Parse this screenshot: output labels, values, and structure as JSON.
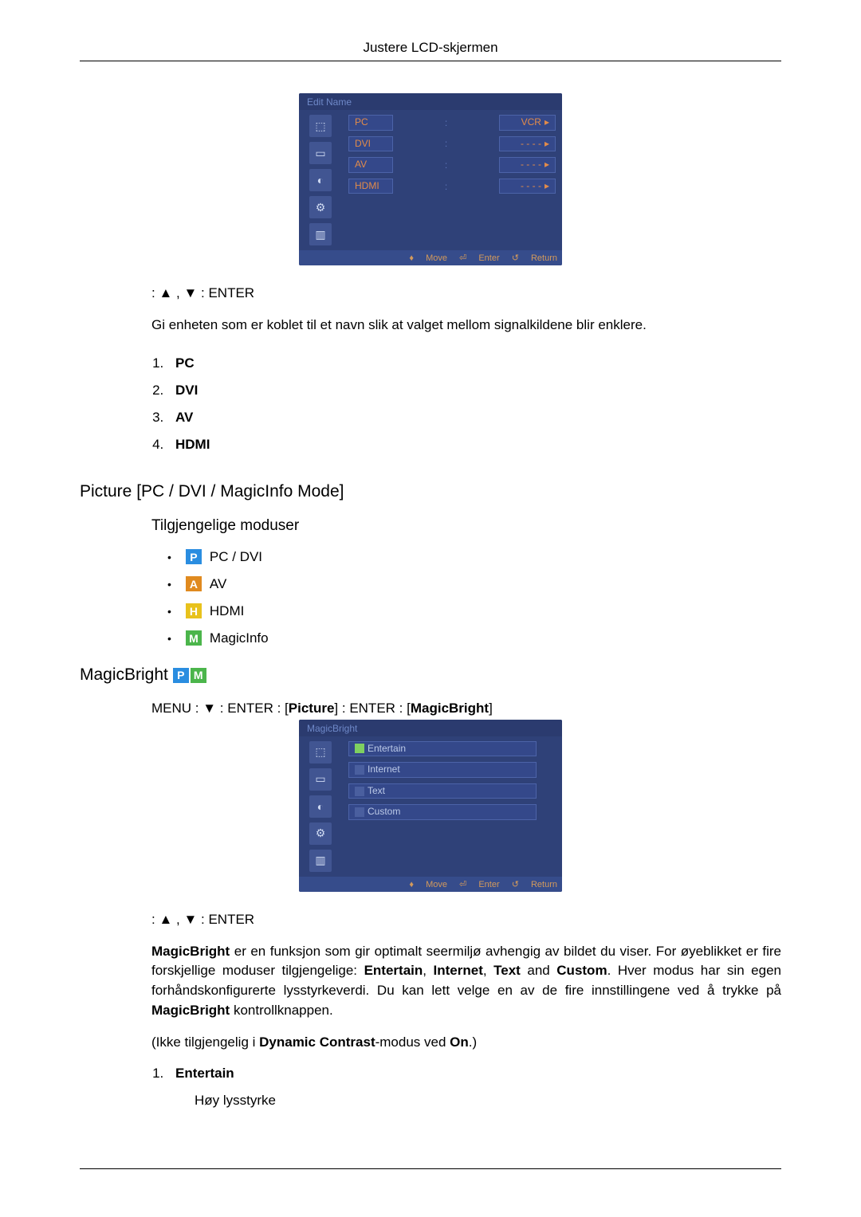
{
  "header": {
    "title": "Justere LCD-skjermen"
  },
  "osd1": {
    "title": "Edit Name",
    "rows": [
      {
        "label": "PC",
        "value": "VCR",
        "arrow": "▸"
      },
      {
        "label": "DVI",
        "value": "- - - -",
        "arrow": "▸"
      },
      {
        "label": "AV",
        "value": "- - - -",
        "arrow": "▸"
      },
      {
        "label": "HDMI",
        "value": "- - - -",
        "arrow": "▸"
      }
    ],
    "footer": {
      "move": "Move",
      "enter": "Enter",
      "ret": "Return"
    }
  },
  "nav1": {
    "prefix": ":  ▲ , ▼  :",
    "enter": "ENTER"
  },
  "intro1": "Gi enheten som er koblet til et navn slik at valget mellom signalkildene blir enklere.",
  "sourceList": [
    "PC",
    "DVI",
    "AV",
    "HDMI"
  ],
  "section1": {
    "title": "Picture [PC / DVI / MagicInfo Mode]"
  },
  "subsection1": {
    "title": "Tilgjengelige moduser"
  },
  "modes": [
    {
      "badge": "P",
      "label": "PC / DVI"
    },
    {
      "badge": "A",
      "label": "AV"
    },
    {
      "badge": "H",
      "label": "HDMI"
    },
    {
      "badge": "M",
      "label": "MagicInfo"
    }
  ],
  "section2": {
    "title": "MagicBright"
  },
  "menupath": {
    "p1": "MENU  :  ▼  :",
    "e1": "ENTER",
    "sep1": "  : [",
    "pic": "Picture",
    "sep2": "]  :",
    "e2": "ENTER",
    "sep3": "  : [",
    "mb": "MagicBright",
    "sep4": "]"
  },
  "osd2": {
    "title": "MagicBright",
    "rows": [
      {
        "label": "Entertain",
        "selected": true
      },
      {
        "label": "Internet",
        "selected": false
      },
      {
        "label": "Text",
        "selected": false
      },
      {
        "label": "Custom",
        "selected": false
      }
    ],
    "footer": {
      "move": "Move",
      "enter": "Enter",
      "ret": "Return"
    }
  },
  "nav2": {
    "prefix": ":  ▲ , ▼  :",
    "enter": "ENTER"
  },
  "mbPara": {
    "b1": "MagicBright",
    "t1": " er en funksjon som gir optimalt seermiljø avhengig av bildet du viser. For øyeblikket er fire forskjellige moduser tilgjengelige: ",
    "b2": "Entertain",
    "c1": ", ",
    "b3": "Internet",
    "c2": ", ",
    "b4": "Text",
    "c3": " and ",
    "b5": "Custom",
    "t2": ". Hver modus har sin egen forhåndskonfigurerte lysstyrkeverdi. Du kan lett velge en av de fire innstillingene ved å trykke på ",
    "b6": "MagicBright",
    "t3": " kontrollknappen."
  },
  "notAvail": {
    "t1": "(Ikke tilgjengelig i ",
    "b1": "Dynamic Contrast",
    "t2": "-modus ved ",
    "b2": "On",
    "t3": ".)"
  },
  "mbList": {
    "i1": "Entertain",
    "i1sub": "Høy lysstyrke"
  }
}
